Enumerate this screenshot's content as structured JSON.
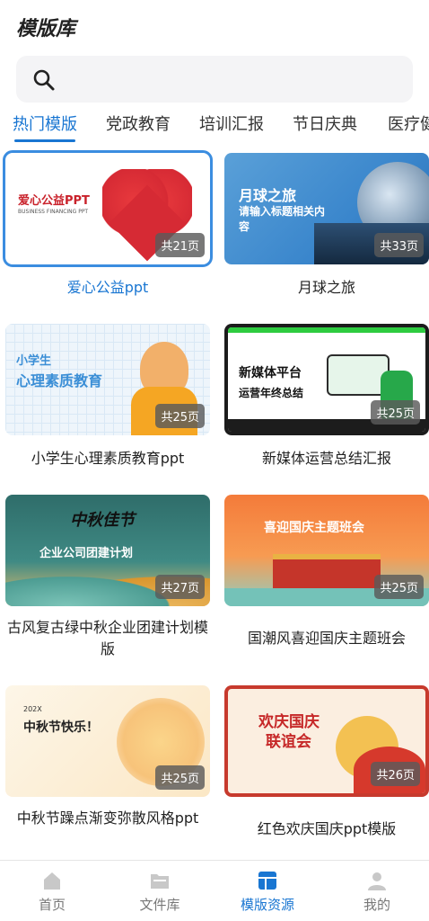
{
  "header": {
    "title": "模版库"
  },
  "search": {
    "placeholder": "",
    "icon": "search-icon"
  },
  "tabs": [
    {
      "label": "热门模版"
    },
    {
      "label": "党政教育"
    },
    {
      "label": "培训汇报"
    },
    {
      "label": "节日庆典"
    },
    {
      "label": "医疗健"
    }
  ],
  "templates": [
    {
      "title": "爱心公益ppt",
      "pages": "共21页",
      "thumb_text": [
        "爱心公益PPT",
        "BUSINESS FINANCING PPT"
      ]
    },
    {
      "title": "月球之旅",
      "pages": "共33页",
      "thumb_text": [
        "月球之旅",
        "请输入标题相关内容"
      ]
    },
    {
      "title": "小学生心理素质教育ppt",
      "pages": "共25页",
      "thumb_text": [
        "小学生",
        "心理素质教育"
      ]
    },
    {
      "title": "新媒体运营总结汇报",
      "pages": "共25页",
      "thumb_text": [
        "新媒体平台",
        "运营年终总结"
      ]
    },
    {
      "title": "古风复古绿中秋企业团建计划模版",
      "pages": "共27页",
      "thumb_text": [
        "中秋佳节",
        "企业公司团建计划"
      ]
    },
    {
      "title": "国潮风喜迎国庆主题班会",
      "pages": "共25页",
      "thumb_text": [
        "喜迎国庆主题班会"
      ]
    },
    {
      "title": "中秋节躁点渐变弥散风格ppt",
      "pages": "共25页",
      "thumb_text": [
        "202X",
        "中秋节快乐！"
      ]
    },
    {
      "title": "红色欢庆国庆ppt模版",
      "pages": "共26页",
      "thumb_text": [
        "欢庆国庆",
        "联谊会"
      ]
    }
  ],
  "nav": [
    {
      "label": "首页",
      "icon": "home-icon"
    },
    {
      "label": "文件库",
      "icon": "folder-icon"
    },
    {
      "label": "模版资源",
      "icon": "template-icon"
    },
    {
      "label": "我的",
      "icon": "user-icon"
    }
  ],
  "colors": {
    "accent": "#1976d2",
    "badge": "#5a5a5a"
  }
}
